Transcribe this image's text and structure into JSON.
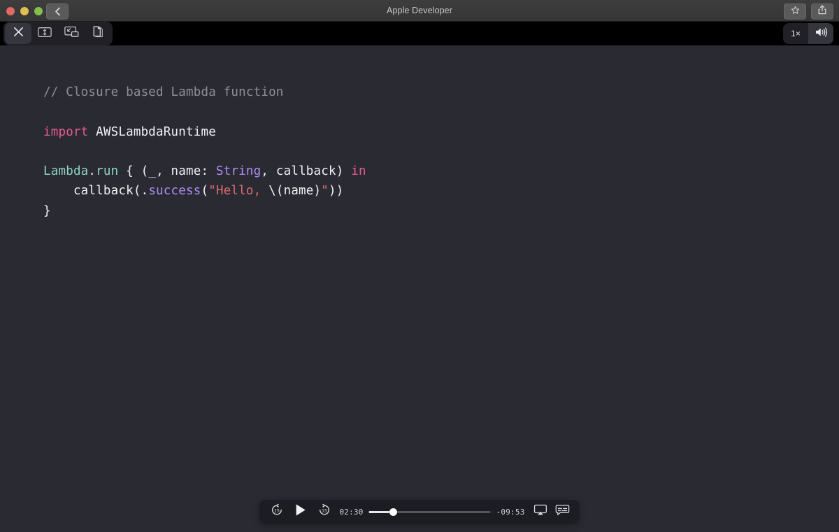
{
  "window": {
    "title": "Apple Developer",
    "traffic_lights": [
      "close",
      "minimize",
      "zoom"
    ],
    "back_button_icon": "chevron-left-icon",
    "favorite_icon": "star-icon",
    "share_icon": "share-icon"
  },
  "player_toolbar": {
    "close_label": "close-player",
    "buttons": [
      {
        "name": "close-player-button",
        "icon": "close-x-icon"
      },
      {
        "name": "fit-to-window-button",
        "icon": "fit-screen-icon"
      },
      {
        "name": "picture-in-picture-button",
        "icon": "picture-in-picture-icon"
      },
      {
        "name": "duplicate-window-button",
        "icon": "copy-document-icon"
      }
    ],
    "playback_speed": "1×",
    "volume_icon": "volume-high-icon"
  },
  "video": {
    "code_title": "Closure based Lambda function",
    "lines": [
      {
        "id": "line-comment",
        "tokens": [
          {
            "text": "// Closure based Lambda function",
            "kind": "comment"
          }
        ]
      },
      {
        "id": "line-blank-1",
        "tokens": []
      },
      {
        "id": "line-import",
        "tokens": [
          {
            "text": "import",
            "kind": "keyword"
          },
          {
            "text": " AWSLambdaRuntime",
            "kind": "plain"
          }
        ]
      },
      {
        "id": "line-blank-2",
        "tokens": []
      },
      {
        "id": "line-lambda-run",
        "tokens": [
          {
            "text": "Lambda",
            "kind": "teal"
          },
          {
            "text": ".",
            "kind": "plain"
          },
          {
            "text": "run",
            "kind": "teal"
          },
          {
            "text": " { (_, name: ",
            "kind": "plain"
          },
          {
            "text": "String",
            "kind": "type"
          },
          {
            "text": ", callback) ",
            "kind": "plain"
          },
          {
            "text": "in",
            "kind": "keyword"
          }
        ]
      },
      {
        "id": "line-callback",
        "tokens": [
          {
            "text": "    callback(.",
            "kind": "plain"
          },
          {
            "text": "success",
            "kind": "type"
          },
          {
            "text": "(",
            "kind": "plain"
          },
          {
            "text": "\"Hello, ",
            "kind": "string"
          },
          {
            "text": "\\(name)",
            "kind": "plain"
          },
          {
            "text": "\"",
            "kind": "string"
          },
          {
            "text": "))",
            "kind": "plain"
          }
        ]
      },
      {
        "id": "line-close-brace",
        "tokens": [
          {
            "text": "}",
            "kind": "plain"
          }
        ]
      }
    ]
  },
  "transport": {
    "skip_back_label": "15",
    "skip_forward_label": "15",
    "play_icon": "play-icon",
    "current_time": "02:30",
    "remaining_time": "-09:53",
    "progress_percent": 20.2,
    "airplay_icon": "airplay-icon",
    "captions_icon": "closed-captions-icon"
  },
  "colors": {
    "background": "#2a2a33",
    "titlebar": "#3a3a3a",
    "keyword": "#ec5c93",
    "type": "#b28df5",
    "teal": "#8fd6c4",
    "string": "#e06c6c",
    "comment": "#8e9096",
    "plain": "#f2f2f4"
  }
}
